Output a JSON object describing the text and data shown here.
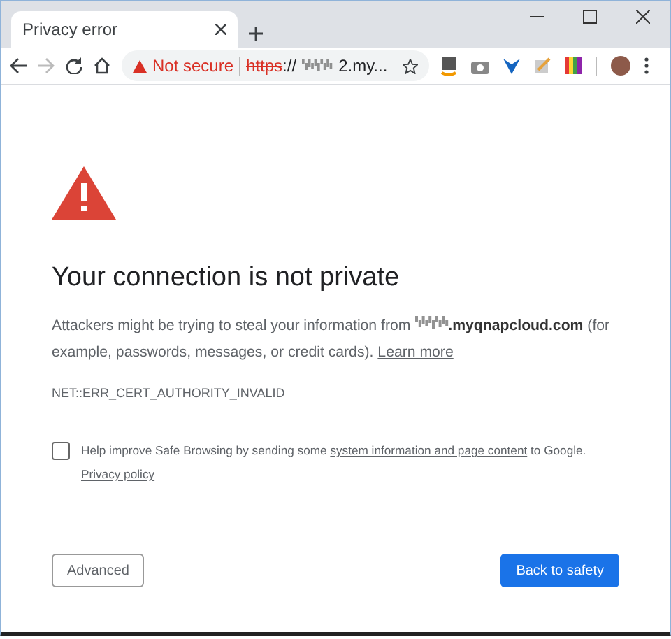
{
  "tab": {
    "title": "Privacy error"
  },
  "address_bar": {
    "security_label": "Not secure",
    "scheme": "https",
    "separator": "://",
    "host_end": "2.my..."
  },
  "page": {
    "heading": "Your connection is not private",
    "message_start": "Attackers might be trying to steal your information from",
    "host": "**.myqnapcloud.com**",
    "message_end": "(for example, passwords, messages, or credit cards).",
    "learn_more": "Learn more",
    "error_code": "NET::ERR_CERT_AUTHORITY_INVALID",
    "opt_in": {
      "checked": false,
      "text_start": "Help improve Safe Browsing by sending some",
      "link": "system information and page content",
      "text_end": "to Google.",
      "policy_link": "Privacy policy"
    },
    "buttons": [
      {
        "label": "Advanced",
        "kind": "secondary"
      },
      {
        "label": "Back to safety",
        "kind": "primary"
      }
    ]
  }
}
